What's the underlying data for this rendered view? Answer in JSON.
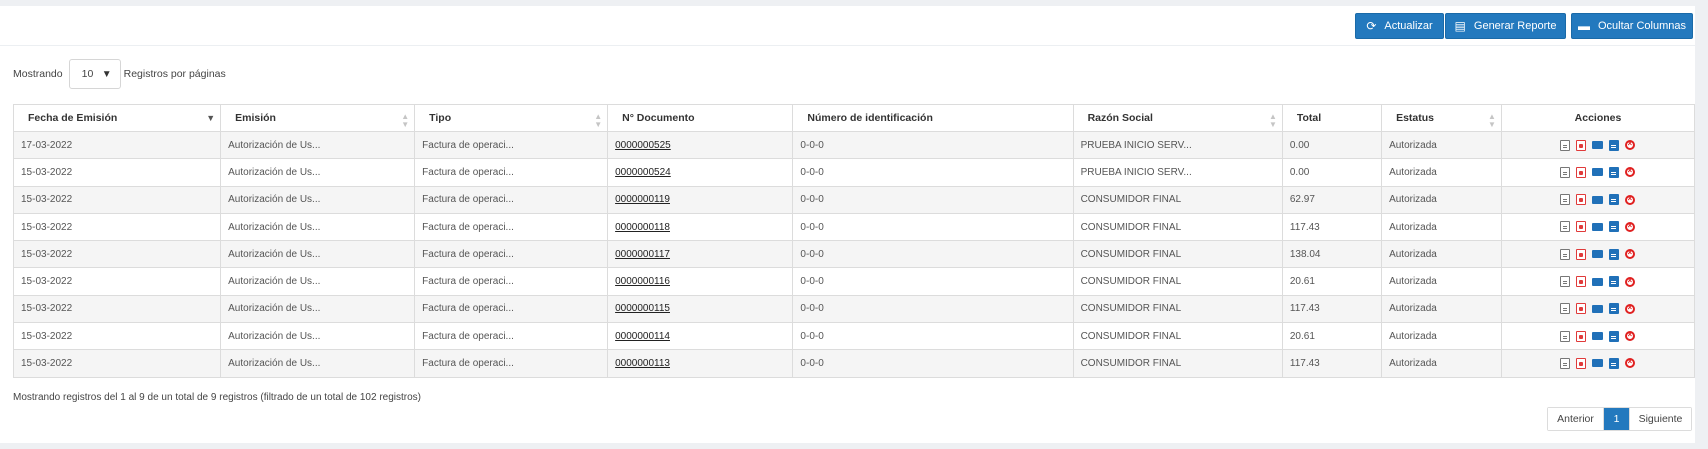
{
  "toolbar": {
    "refresh_label": "Actualizar",
    "report_label": "Generar Reporte",
    "hide_columns_label": "Ocultar Columnas"
  },
  "length_menu": {
    "prefix": "Mostrando",
    "value": "10",
    "suffix": "Registros por páginas"
  },
  "table": {
    "headers": [
      "Fecha de Emisión",
      "Emisión",
      "Tipo",
      "N° Documento",
      "Número de identificación",
      "Razón Social",
      "Total",
      "Estatus",
      "Acciones"
    ],
    "rows": [
      {
        "fecha": "17-03-2022",
        "emision": "Autorización de Us...",
        "tipo": "Factura de operaci...",
        "documento": "0000000525",
        "identificacion": "0-0-0",
        "razon": "PRUEBA INICIO SERV...",
        "total": "0.00",
        "estatus": "Autorizada"
      },
      {
        "fecha": "15-03-2022",
        "emision": "Autorización de Us...",
        "tipo": "Factura de operaci...",
        "documento": "0000000524",
        "identificacion": "0-0-0",
        "razon": "PRUEBA INICIO SERV...",
        "total": "0.00",
        "estatus": "Autorizada"
      },
      {
        "fecha": "15-03-2022",
        "emision": "Autorización de Us...",
        "tipo": "Factura de operaci...",
        "documento": "0000000119",
        "identificacion": "0-0-0",
        "razon": "CONSUMIDOR FINAL",
        "total": "62.97",
        "estatus": "Autorizada"
      },
      {
        "fecha": "15-03-2022",
        "emision": "Autorización de Us...",
        "tipo": "Factura de operaci...",
        "documento": "0000000118",
        "identificacion": "0-0-0",
        "razon": "CONSUMIDOR FINAL",
        "total": "117.43",
        "estatus": "Autorizada"
      },
      {
        "fecha": "15-03-2022",
        "emision": "Autorización de Us...",
        "tipo": "Factura de operaci...",
        "documento": "0000000117",
        "identificacion": "0-0-0",
        "razon": "CONSUMIDOR FINAL",
        "total": "138.04",
        "estatus": "Autorizada"
      },
      {
        "fecha": "15-03-2022",
        "emision": "Autorización de Us...",
        "tipo": "Factura de operaci...",
        "documento": "0000000116",
        "identificacion": "0-0-0",
        "razon": "CONSUMIDOR FINAL",
        "total": "20.61",
        "estatus": "Autorizada"
      },
      {
        "fecha": "15-03-2022",
        "emision": "Autorización de Us...",
        "tipo": "Factura de operaci...",
        "documento": "0000000115",
        "identificacion": "0-0-0",
        "razon": "CONSUMIDOR FINAL",
        "total": "117.43",
        "estatus": "Autorizada"
      },
      {
        "fecha": "15-03-2022",
        "emision": "Autorización de Us...",
        "tipo": "Factura de operaci...",
        "documento": "0000000114",
        "identificacion": "0-0-0",
        "razon": "CONSUMIDOR FINAL",
        "total": "20.61",
        "estatus": "Autorizada"
      },
      {
        "fecha": "15-03-2022",
        "emision": "Autorización de Us...",
        "tipo": "Factura de operaci...",
        "documento": "0000000113",
        "identificacion": "0-0-0",
        "razon": "CONSUMIDOR FINAL",
        "total": "117.43",
        "estatus": "Autorizada"
      }
    ],
    "row_actions": [
      "xml-file-icon",
      "pdf-icon",
      "email-icon",
      "document-icon",
      "cancel-icon"
    ]
  },
  "footer": {
    "info": "Mostrando registros del 1 al 9 de un total de 9 registros (filtrado de un total de 102 registros)",
    "prev_label": "Anterior",
    "current_page": "1",
    "next_label": "Siguiente"
  },
  "colors": {
    "primary": "#2379be",
    "danger": "#e03a3a"
  }
}
